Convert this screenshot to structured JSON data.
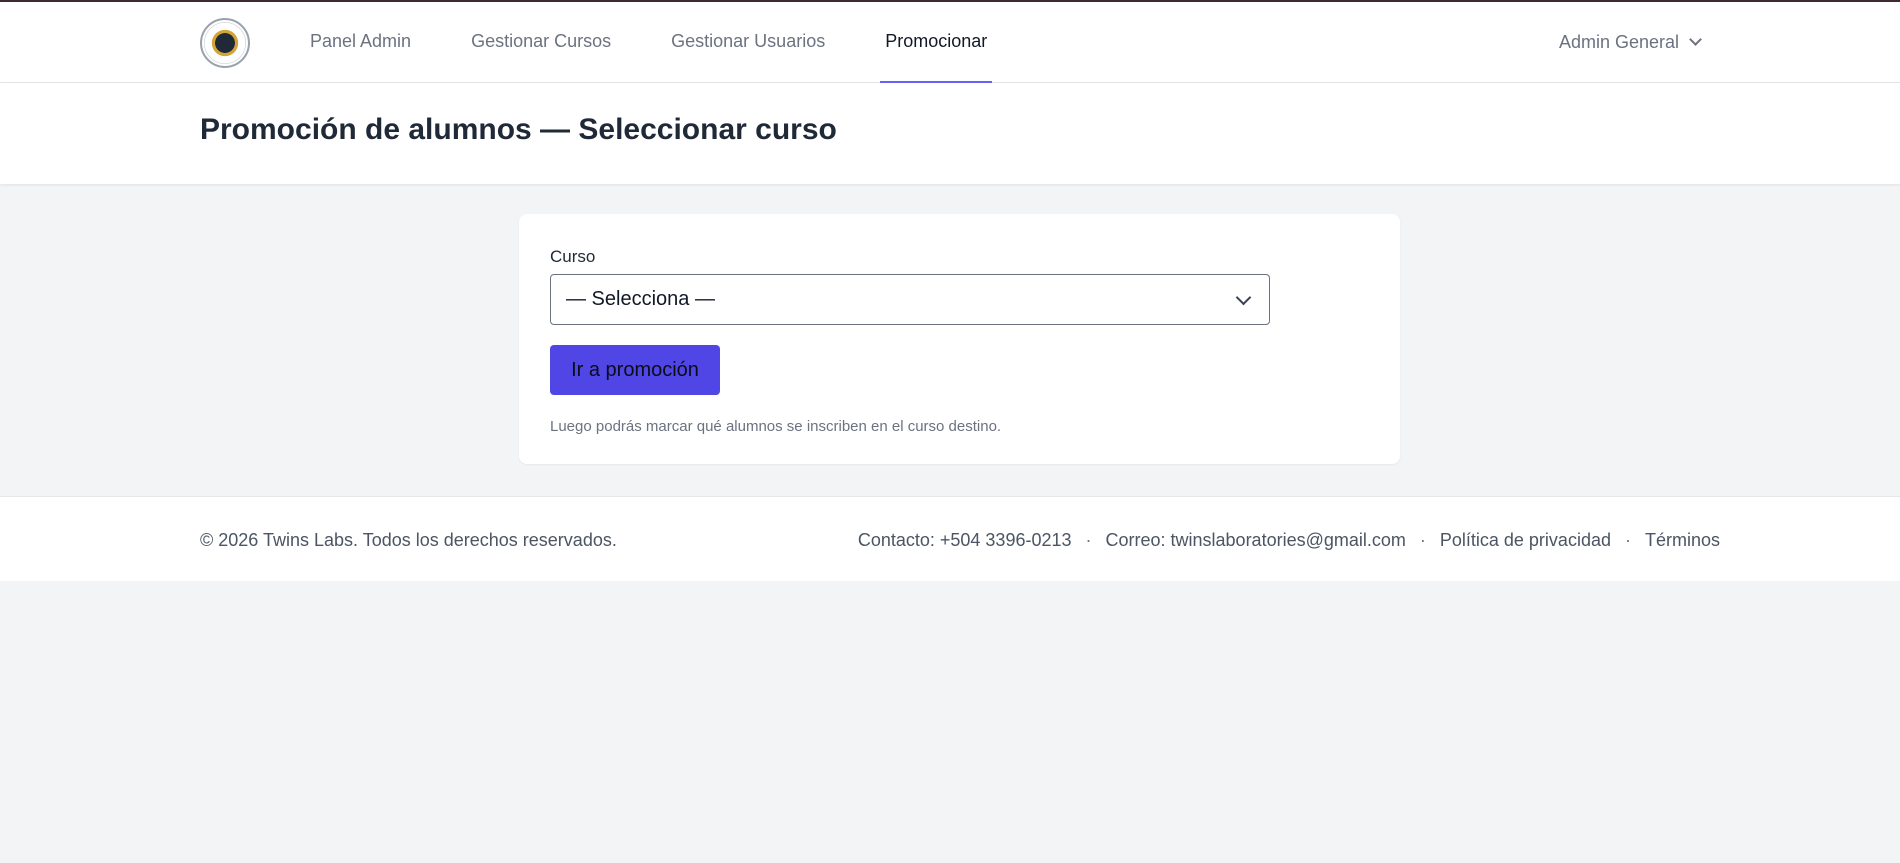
{
  "nav": {
    "links": [
      {
        "label": "Panel Admin",
        "active": false
      },
      {
        "label": "Gestionar Cursos",
        "active": false
      },
      {
        "label": "Gestionar Usuarios",
        "active": false
      },
      {
        "label": "Promocionar",
        "active": true
      }
    ],
    "user": "Admin General"
  },
  "header": {
    "title": "Promoción de alumnos — Seleccionar curso"
  },
  "form": {
    "label": "Curso",
    "select_value": "— Selecciona —",
    "button": "Ir a promoción",
    "hint": "Luego podrás marcar qué alumnos se inscriben en el curso destino."
  },
  "footer": {
    "copyright": "© 2026 Twins Labs. Todos los derechos reservados.",
    "contact": "Contacto: +504 3396-0213",
    "email": "Correo: twinslaboratories@gmail.com",
    "privacy": "Política de privacidad",
    "terms": "Términos",
    "separator": "·"
  },
  "colors": {
    "accent": "#4f46e5",
    "active_underline": "#6366f1"
  }
}
